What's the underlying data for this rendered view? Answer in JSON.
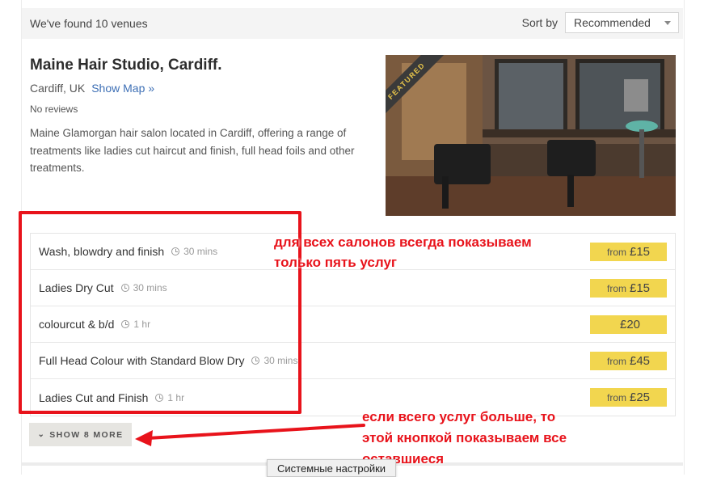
{
  "results": {
    "count_text": "We've found 10 venues",
    "sort_label": "Sort by",
    "sort_value": "Recommended"
  },
  "venue": {
    "name": "Maine Hair Studio, Cardiff.",
    "location": "Cardiff, UK",
    "show_map": "Show Map",
    "show_map_icon": "»",
    "reviews": "No reviews",
    "description": "Maine Glamorgan hair salon located in Cardiff, offering a range of treatments like ladies cut haircut and finish, full head foils and other treatments.",
    "featured_label": "FEATURED"
  },
  "services": [
    {
      "name": "Wash, blowdry and finish",
      "duration": "30 mins",
      "price_prefix": "from",
      "price": "£15"
    },
    {
      "name": "Ladies Dry Cut",
      "duration": "30 mins",
      "price_prefix": "from",
      "price": "£15"
    },
    {
      "name": "colourcut & b/d",
      "duration": "1 hr",
      "price_prefix": "",
      "price": "£20"
    },
    {
      "name": "Full Head Colour with Standard Blow Dry",
      "duration": "30 mins",
      "price_prefix": "from",
      "price": "£45"
    },
    {
      "name": "Ladies Cut and Finish",
      "duration": "1 hr",
      "price_prefix": "from",
      "price": "£25"
    }
  ],
  "show_more": {
    "icon": "»",
    "label": "SHOW 8 MORE"
  },
  "annotations": {
    "top": "для всех салонов всегда показываем\nтолько пять услуг",
    "bottom": "если всего услуг больше, то\nэтой кнопкой показываем все\nоставшиеся"
  },
  "tooltip": "Системные настройки",
  "colors": {
    "accent_price": "#f2d64f",
    "link": "#3d6fb5",
    "annotation": "#e8131b"
  }
}
